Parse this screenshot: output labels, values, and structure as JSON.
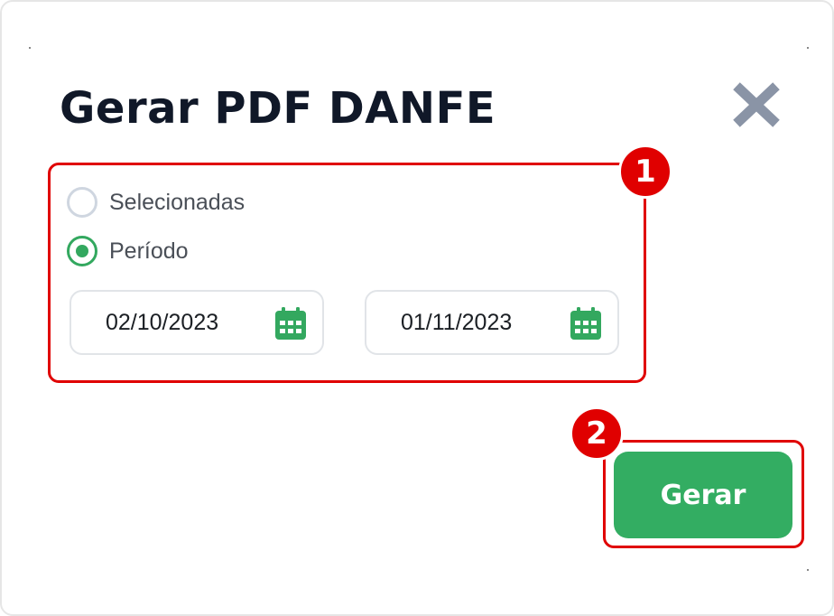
{
  "dialog": {
    "title": "Gerar PDF DANFE",
    "close_icon": "close-x-icon"
  },
  "options": {
    "items": [
      {
        "label": "Selecionadas",
        "checked": false
      },
      {
        "label": "Período",
        "checked": true
      }
    ]
  },
  "dates": {
    "start": {
      "value": "02/10/2023",
      "icon": "calendar-icon"
    },
    "end": {
      "value": "01/11/2023",
      "icon": "calendar-icon"
    }
  },
  "annotations": {
    "badge_1": "1",
    "badge_2": "2"
  },
  "actions": {
    "generate_label": "Gerar"
  },
  "colors": {
    "accent_green": "#33ad62",
    "annotation_red": "#e00000",
    "close_gray": "#8a94a6",
    "title_text": "#101828"
  }
}
